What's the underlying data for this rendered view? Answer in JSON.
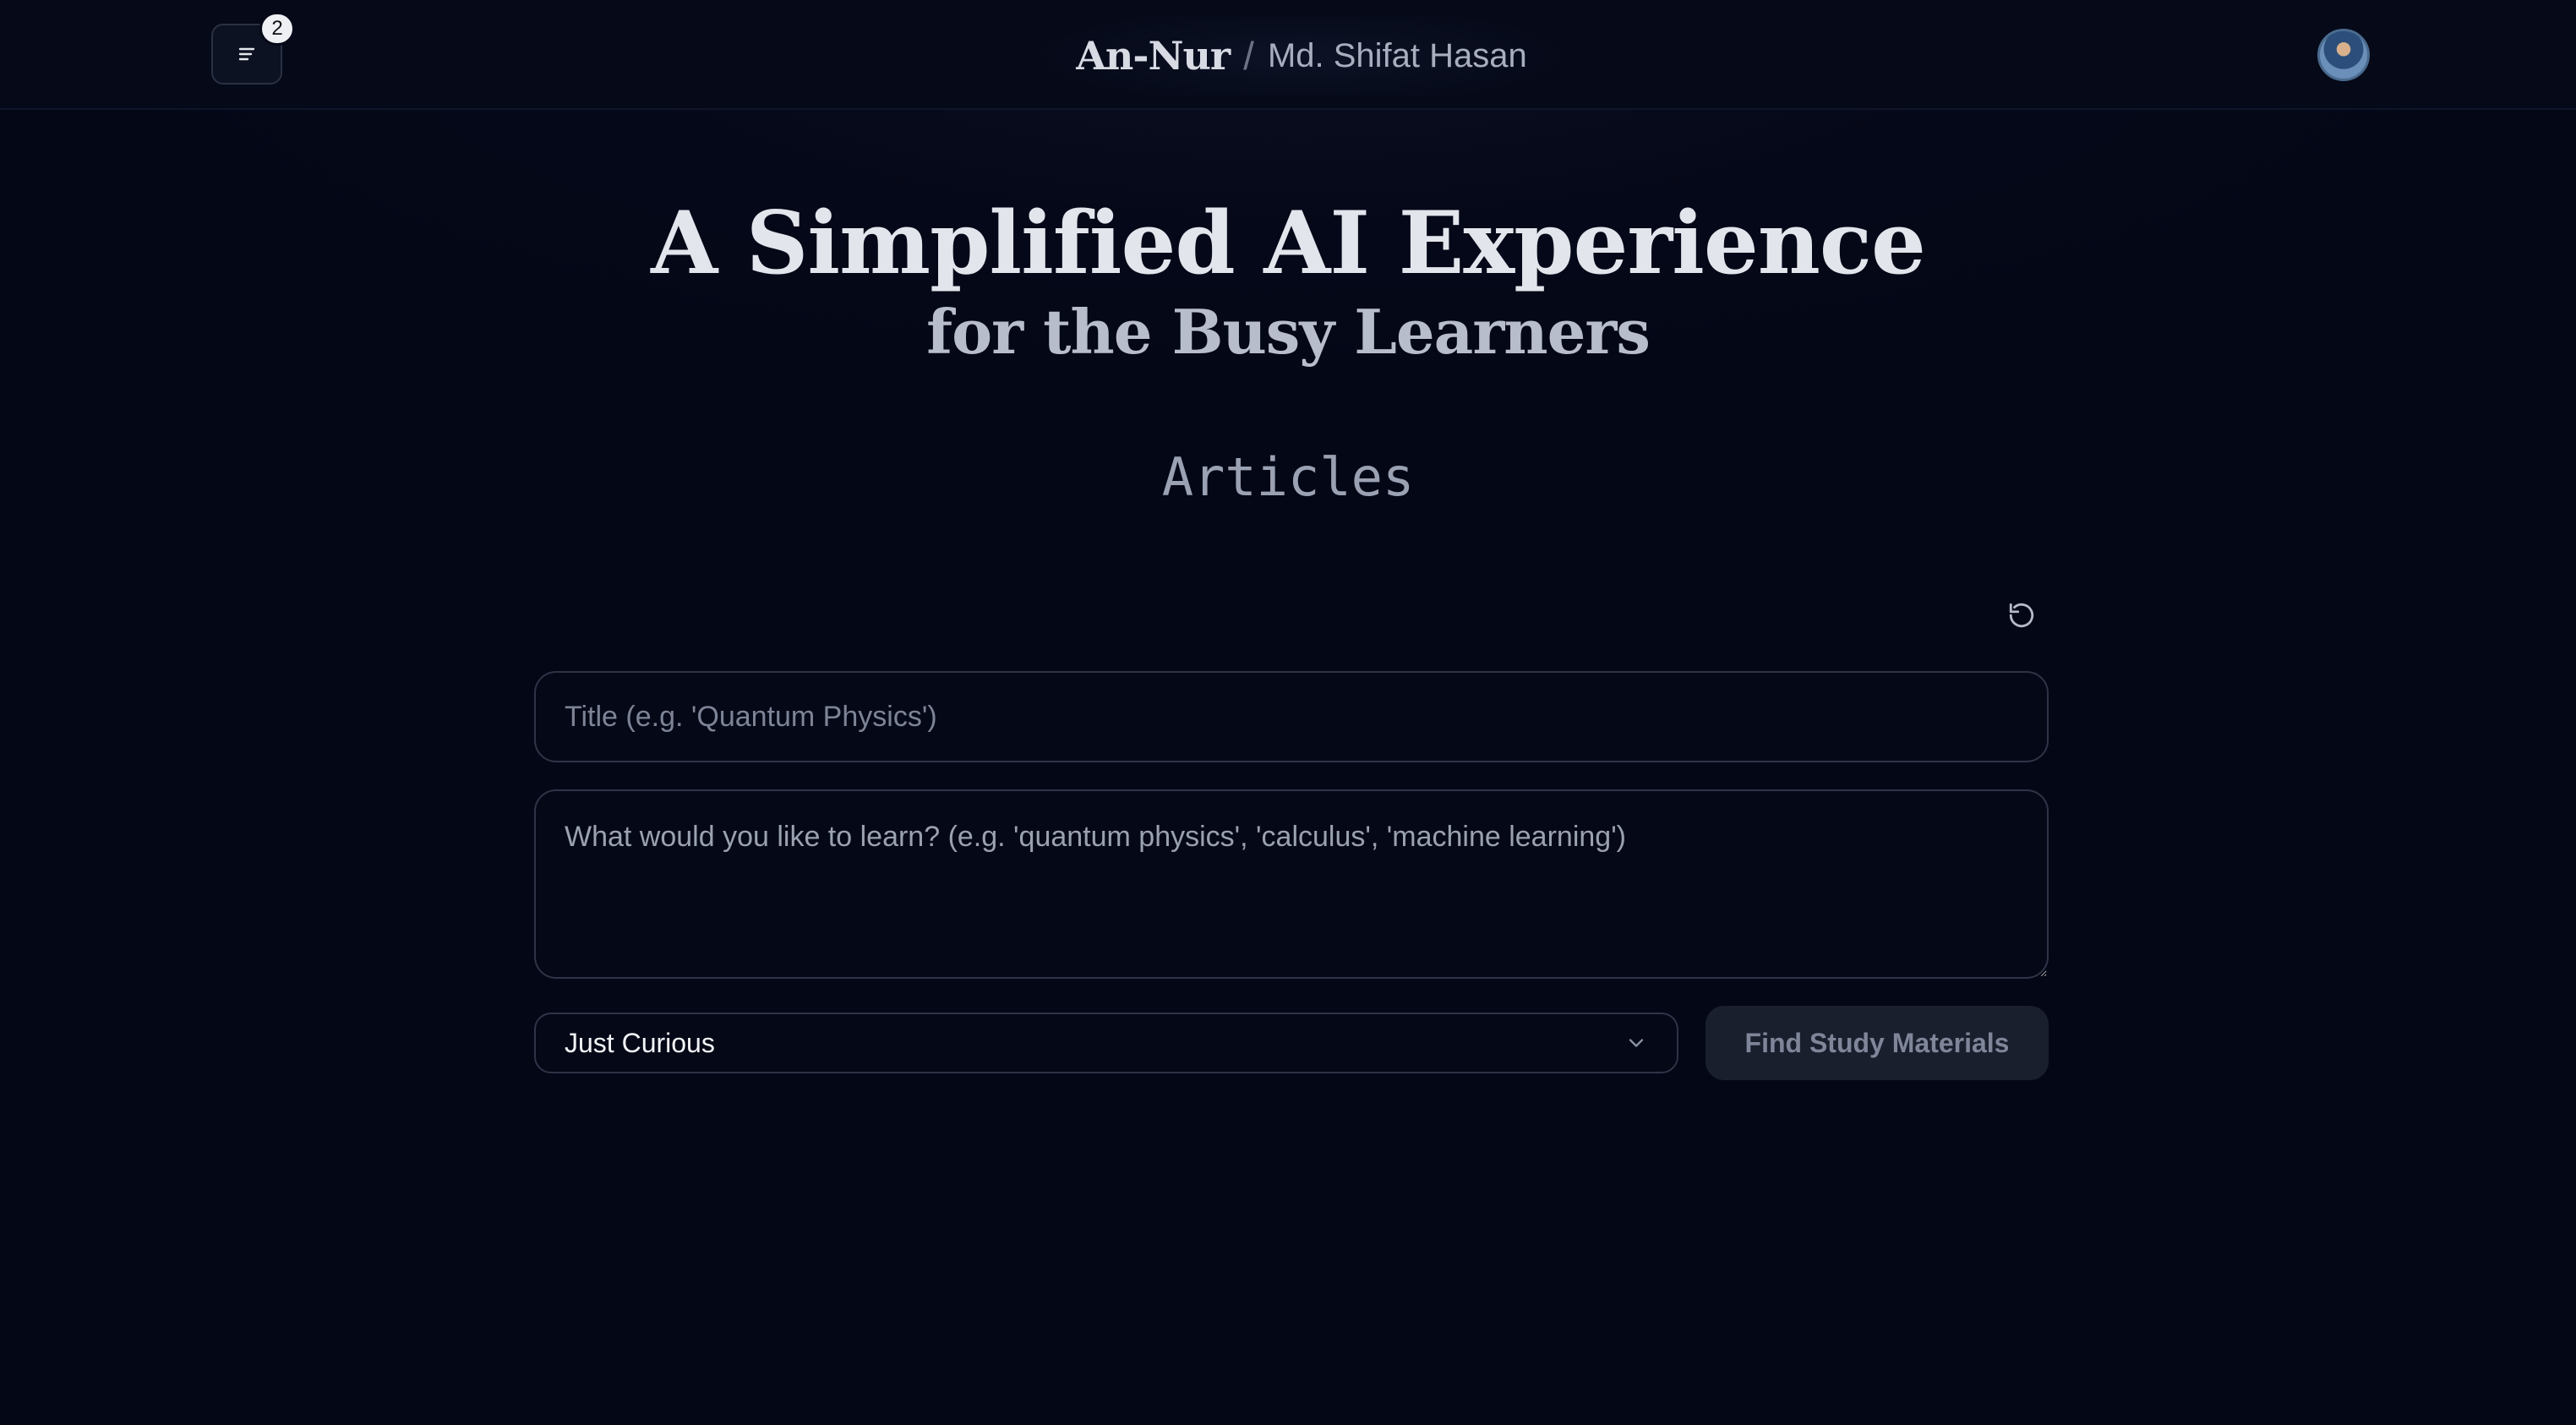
{
  "header": {
    "menu_badge_count": "2",
    "brand_name": "An-Nur",
    "separator": "/",
    "user_name": "Md. Shifat Hasan"
  },
  "hero": {
    "title": "A Simplified AI Experience",
    "subtitle": "for the Busy Learners"
  },
  "section": {
    "title": "Articles"
  },
  "form": {
    "title_placeholder": "Title (e.g. 'Quantum Physics')",
    "title_value": "",
    "learn_placeholder": "What would you like to learn? (e.g. 'quantum physics', 'calculus', 'machine learning')",
    "learn_value": "",
    "level_selected": "Just Curious",
    "submit_label": "Find Study Materials"
  },
  "icons": {
    "menu": "menu-lines-icon",
    "reset": "refresh-icon",
    "dropdown": "chevron-down-icon"
  },
  "colors": {
    "background": "#040716",
    "heading": "#e3e5ec",
    "subheading": "#b7bdcb",
    "border": "#2e3447",
    "button_bg": "#1a1f2d",
    "button_text": "#7f8699"
  }
}
